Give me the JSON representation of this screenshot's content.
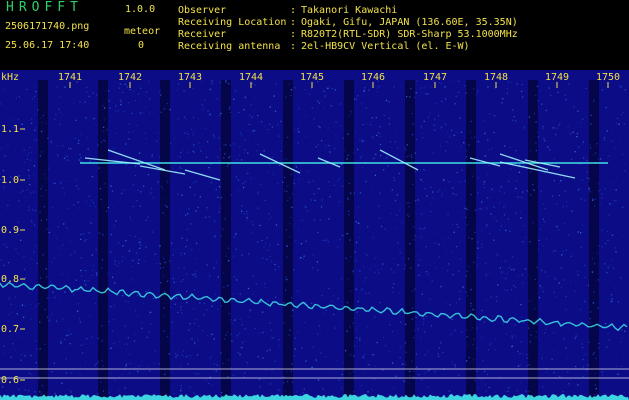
{
  "header": {
    "app_title": "HROFFT",
    "app_version": "1.0.0",
    "file_name": "2506171740.png",
    "date_time": "25.06.17 17:40",
    "detection_label": "meteor",
    "detection_count": "0"
  },
  "station": {
    "observer_label": "Observer",
    "observer_value": "Takanori Kawachi",
    "location_label": "Receiving Location",
    "location_value": "Ogaki, Gifu, JAPAN (136.60E, 35.35N)",
    "receiver_label": "Receiver",
    "receiver_value": "R820T2(RTL-SDR) SDR-Sharp 53.1000MHz",
    "antenna_label": "Receiving antenna",
    "antenna_value": "2el-HB9CV Vertical (el. E-W)",
    "separator": ":"
  },
  "spectrogram": {
    "y_unit": "kHz",
    "y_ticks": [
      "1.1",
      "1.0",
      "0.9",
      "0.8",
      "0.7",
      "0.6"
    ],
    "x_ticks": [
      "1741",
      "1742",
      "1743",
      "1744",
      "1745",
      "1746",
      "1747",
      "1748",
      "1749",
      "1750"
    ],
    "colors": {
      "background": "#0b0c86",
      "stripe": "#05054a",
      "noise": "#1d3fd0",
      "carrier": "#3fe0e6",
      "meteor": "#9ff0ff",
      "guide_line": "#d8d8f0",
      "text": "#f2e24a"
    }
  }
}
